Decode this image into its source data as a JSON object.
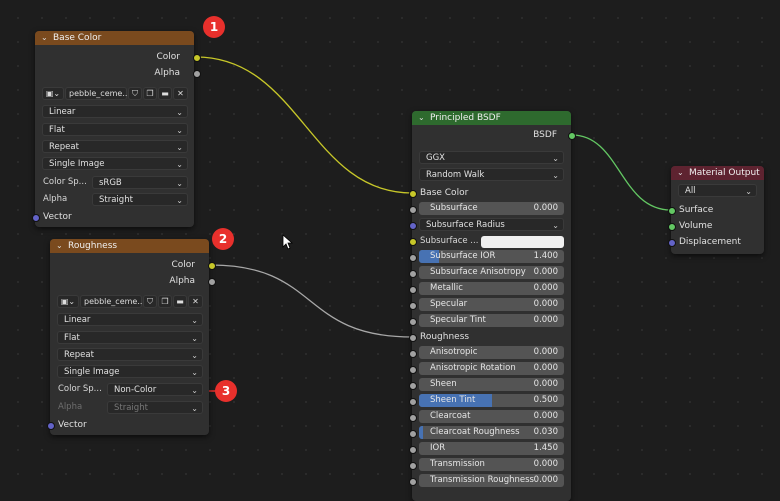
{
  "accent_colors": {
    "texture_header": "#7a4a1e",
    "shader_header": "#2e6a2e",
    "output_header": "#5e2330",
    "socket_color": "#c7c729",
    "socket_float": "#a1a1a1",
    "socket_vector": "#6363c7",
    "socket_shader": "#63c763",
    "slider_fill": "#4772b3",
    "annotation": "#e8302c"
  },
  "base_color_node": {
    "title": "Base Color",
    "outputs": {
      "color": "Color",
      "alpha": "Alpha"
    },
    "image_name": "pebble_ceme...",
    "interpolation": "Linear",
    "projection": "Flat",
    "extension": "Repeat",
    "source": "Single Image",
    "color_space_label": "Color Sp...",
    "color_space": "sRGB",
    "alpha_label": "Alpha",
    "alpha_mode": "Straight",
    "vector_label": "Vector"
  },
  "roughness_node": {
    "title": "Roughness",
    "outputs": {
      "color": "Color",
      "alpha": "Alpha"
    },
    "image_name": "pebble_ceme...",
    "interpolation": "Linear",
    "projection": "Flat",
    "extension": "Repeat",
    "source": "Single Image",
    "color_space_label": "Color Sp...",
    "color_space": "Non-Color",
    "alpha_label": "Alpha",
    "alpha_mode": "Straight",
    "vector_label": "Vector"
  },
  "bsdf_node": {
    "title": "Principled BSDF",
    "output": "BSDF",
    "distribution": "GGX",
    "subsurface_method": "Random Walk",
    "base_color_label": "Base Color",
    "subsurface": {
      "label": "Subsurface",
      "value": "0.000",
      "fill": 0
    },
    "subsurface_radius": "Subsurface Radius",
    "subsurface_color_label": "Subsurface ...",
    "subsurface_ior": {
      "label": "Subsurface IOR",
      "value": "1.400",
      "fill": 0.14
    },
    "subsurface_anisotropy": {
      "label": "Subsurface Anisotropy",
      "value": "0.000",
      "fill": 0
    },
    "metallic": {
      "label": "Metallic",
      "value": "0.000",
      "fill": 0
    },
    "specular": {
      "label": "Specular",
      "value": "0.000",
      "fill": 0
    },
    "specular_tint": {
      "label": "Specular Tint",
      "value": "0.000",
      "fill": 0
    },
    "roughness_label": "Roughness",
    "anisotropic": {
      "label": "Anisotropic",
      "value": "0.000",
      "fill": 0
    },
    "anisotropic_rotation": {
      "label": "Anisotropic Rotation",
      "value": "0.000",
      "fill": 0
    },
    "sheen": {
      "label": "Sheen",
      "value": "0.000",
      "fill": 0
    },
    "sheen_tint": {
      "label": "Sheen Tint",
      "value": "0.500",
      "fill": 0.5
    },
    "clearcoat": {
      "label": "Clearcoat",
      "value": "0.000",
      "fill": 0
    },
    "clearcoat_roughness": {
      "label": "Clearcoat Roughness",
      "value": "0.030",
      "fill": 0.03
    },
    "ior": {
      "label": "IOR",
      "value": "1.450",
      "fill": 0
    },
    "transmission": {
      "label": "Transmission",
      "value": "0.000",
      "fill": 0
    },
    "transmission_roughness": {
      "label": "Transmission Roughness",
      "value": "0.000",
      "fill": 0
    }
  },
  "output_node": {
    "title": "Material Output",
    "target": "All",
    "inputs": {
      "surface": "Surface",
      "volume": "Volume",
      "displacement": "Displacement"
    }
  },
  "annotations": [
    "1",
    "2",
    "3"
  ]
}
